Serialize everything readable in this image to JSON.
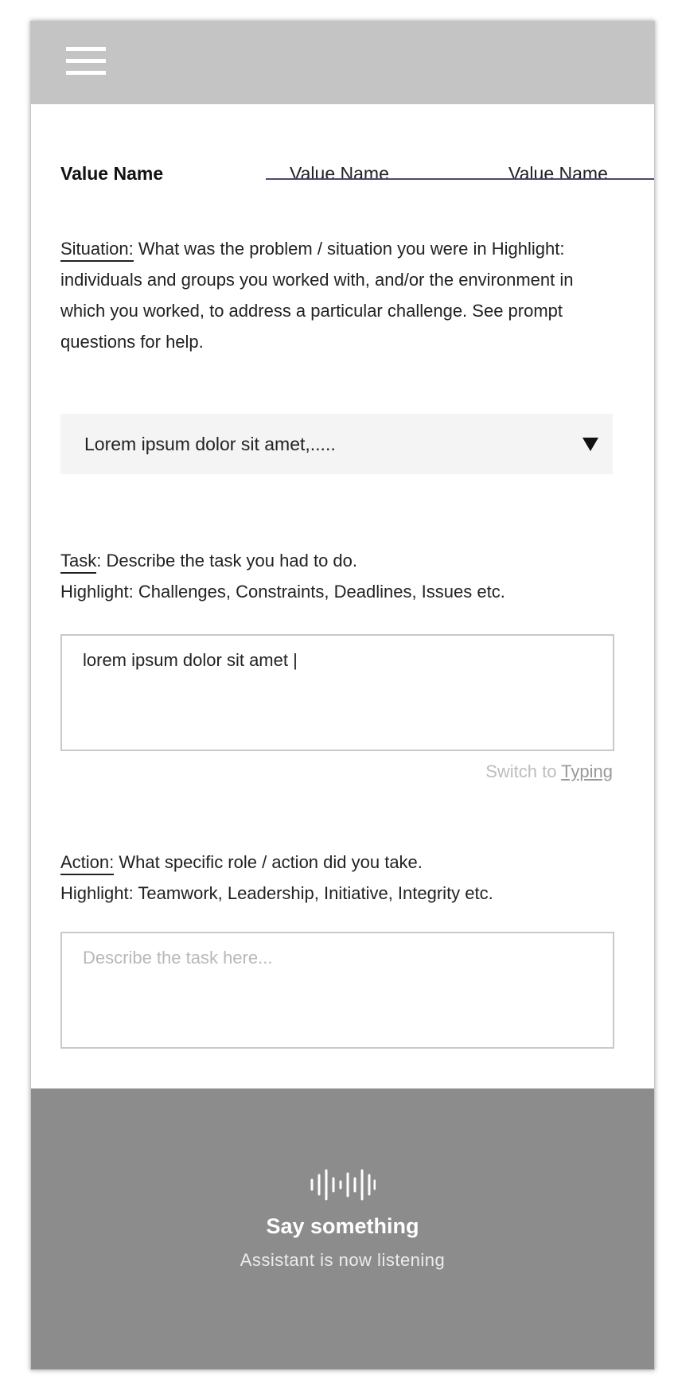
{
  "colors": {
    "topbar": "#c4c4c4",
    "tab_underline": "#4a4d6a",
    "select_bg": "#f4f4f4",
    "assistant_panel": "#8c8c8c",
    "placeholder": "#b8b8b8"
  },
  "header": {
    "menu_icon": "hamburger-menu-icon"
  },
  "tabs": [
    {
      "label": "Value Name",
      "active": false
    },
    {
      "label": "Value Name",
      "active": true
    },
    {
      "label": "Value Name",
      "active": false
    }
  ],
  "situation": {
    "key": "Situation:",
    "text": " What was the problem / situation you were in Highlight: individuals and groups you worked with, and/or the environment in which you worked, to address a particular challenge. See prompt questions for help.",
    "select_value": "Lorem ipsum dolor sit amet,.....",
    "caret_icon": "caret-down-icon"
  },
  "task": {
    "key": "Task",
    "text_line1": ": Describe the task you had to do.",
    "text_line2": "Highlight: Challenges, Constraints, Deadlines, Issues etc.",
    "value": "lorem ipsum dolor sit amet |",
    "switch_prefix": "Switch to ",
    "switch_link": "Typing"
  },
  "action": {
    "key": "Action:",
    "text_line1": " What specific role / action did you take.",
    "text_line2": "Highlight: Teamwork, Leadership, Initiative, Integrity etc.",
    "placeholder": "Describe the task here..."
  },
  "assistant": {
    "icon": "voice-waveform-icon",
    "title": "Say something",
    "subtitle": "Assistant is now listening"
  }
}
